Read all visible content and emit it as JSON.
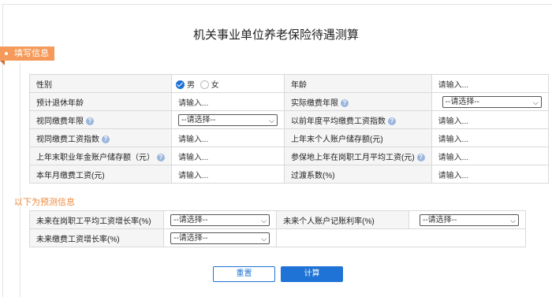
{
  "title": "机关事业单位养老保险待遇测算",
  "section1_tag": "填写信息",
  "section2_title": "以下为预测信息",
  "placeholder": "请输入...",
  "select_placeholder": "--请选择--",
  "gender": {
    "label": "性别",
    "options": [
      "男",
      "女"
    ],
    "selected": "男"
  },
  "age_label": "年龄",
  "retire_age_label": "预计退休年龄",
  "actual_years_label": "实际缴费年限",
  "deemed_years_label": "视同缴费年限",
  "prev_avg_index_label": "以前年度平均缴费工资指数",
  "deemed_wage_index_label": "视同缴费工资指数",
  "last_year_personal_balance_label": "上年末个人账户储存额(元)",
  "last_year_annuity_label": "上年末职业年金账户储存额（元）",
  "local_avg_wage_label": "参保地上年在岗职工月平均工资(元)",
  "current_month_wage_label": "本年月缴费工资(元)",
  "transition_coef_label": "过渡系数(%)",
  "forecast": {
    "wage_growth_label": "未来在岗职工平均工资增长率(%)",
    "personal_interest_label": "未来个人账户记账利率(%)",
    "contrib_growth_label": "未来缴费工资增长率(%)"
  },
  "buttons": {
    "reset": "重置",
    "calc": "计算"
  },
  "colors": {
    "accent": "#1f73d6",
    "tag": "#f59a5a",
    "section2": "#f08a3d"
  }
}
